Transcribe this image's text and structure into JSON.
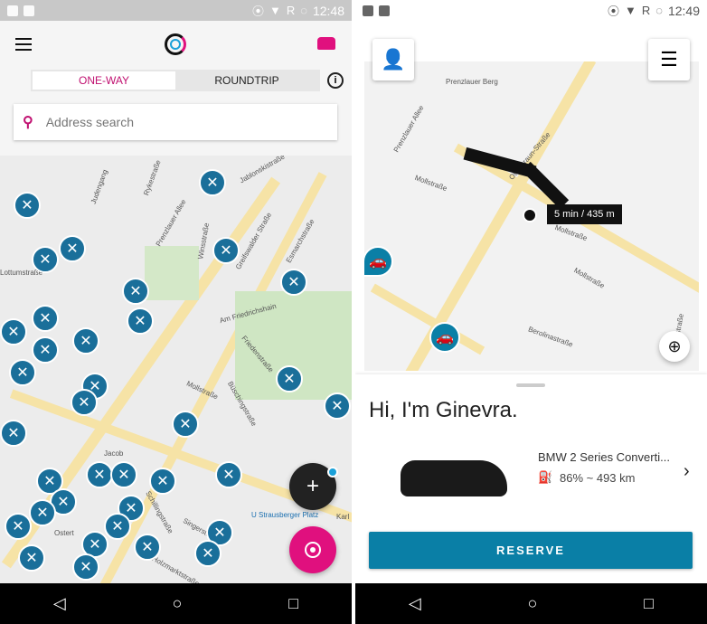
{
  "left": {
    "status": {
      "time": "12:48",
      "carrier": "R"
    },
    "header": {
      "menu_icon": "hamburger-icon",
      "logo": "ring-logo",
      "car_icon": "car-icon",
      "accent": "#e0107e"
    },
    "tabs": [
      {
        "label": "ONE-WAY",
        "active": true
      },
      {
        "label": "ROUNDTRIP",
        "active": false
      }
    ],
    "info_icon": "info-icon",
    "search": {
      "placeholder": "Address search"
    },
    "map_labels": [
      "Judengang",
      "Rykestraße",
      "Jablonskistraße",
      "Prenzlauer Allee",
      "Winsstraße",
      "Greifswalder Straße",
      "Esmarchstraße",
      "Lottumstraße",
      "Am Friedrichshain",
      "Friedenstraße",
      "Mollstraße",
      "Büschingstraße",
      "Schillingstraße",
      "Singerstraße",
      "Holzmarktstraße",
      "U Strausberger Platz",
      "Karl",
      "Jacob",
      "Ostert"
    ],
    "fab_add": "+",
    "fab_locate": "locate-icon"
  },
  "right": {
    "status": {
      "time": "12:49",
      "carrier": "R"
    },
    "profile_icon": "person-icon",
    "filter_icon": "sliders-icon",
    "map_labels": [
      "Prenzlauer Berg",
      "Prenzlauer Allee",
      "Mollstraße",
      "Otto-Braun-Straße",
      "Mollstraße",
      "Mollstraße",
      "Berolinastraße",
      "Berolinastraße"
    ],
    "route_badge": "5 min / 435 m",
    "greeting": "Hi, I'm Ginevra.",
    "car": {
      "name": "BMW 2 Series Converti...",
      "fuel": "86% ~ 493 km"
    },
    "reserve_label": "RESERVE",
    "accent": "#0a7fa6"
  },
  "nav": {
    "back": "◁",
    "home": "○",
    "recents": "□"
  }
}
